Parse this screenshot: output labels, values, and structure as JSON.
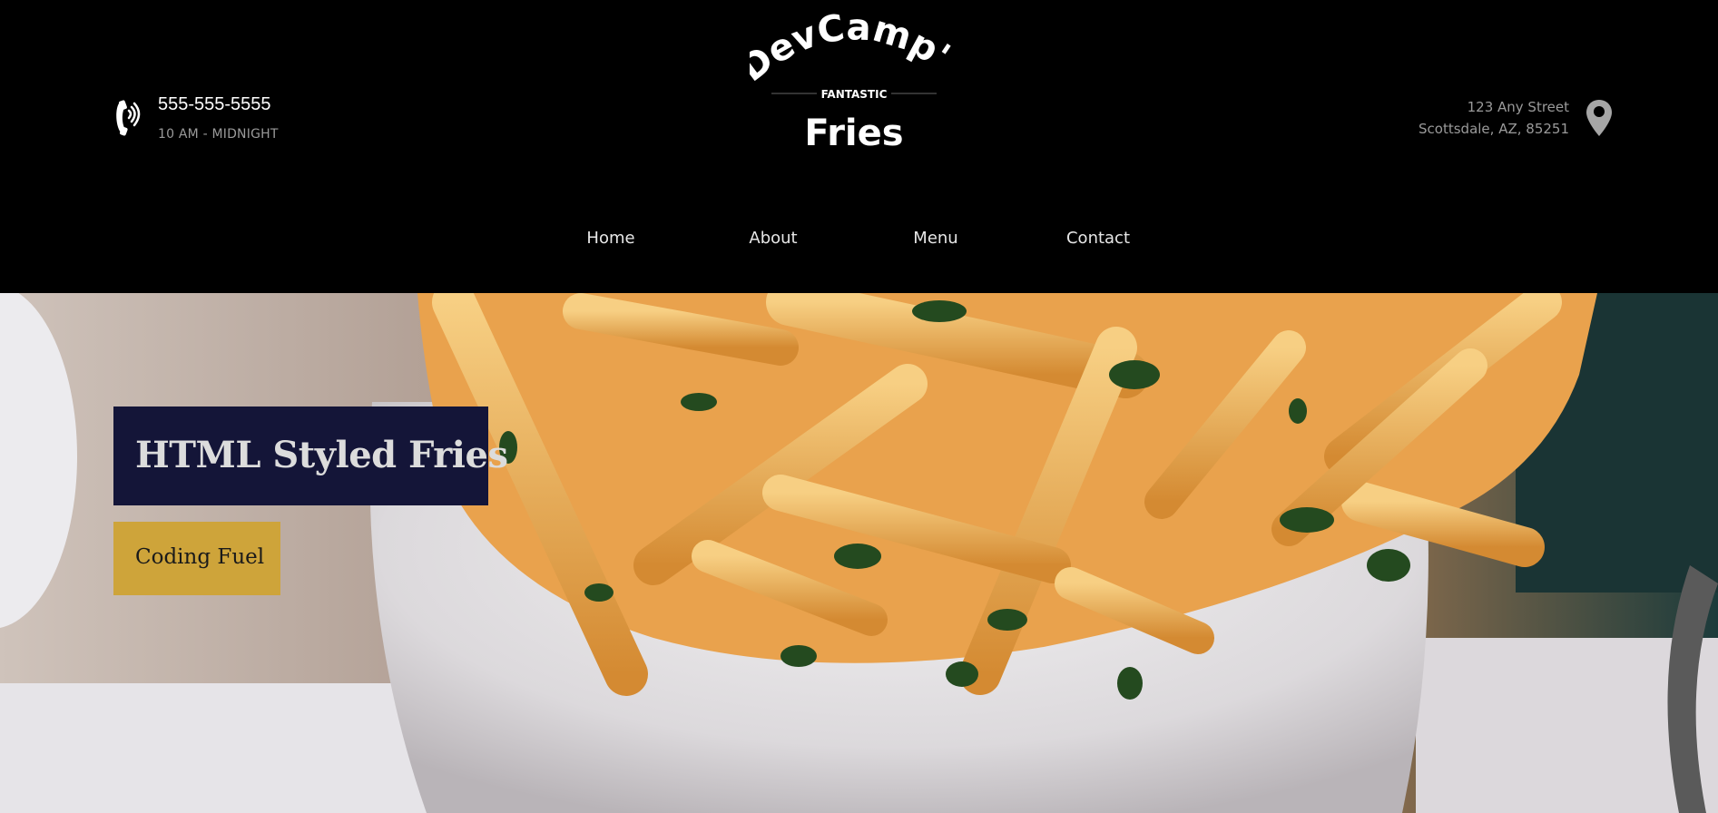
{
  "header": {
    "phone": {
      "icon": "phone-icon",
      "number": "555-555-5555",
      "hours": "10 AM - MIDNIGHT"
    },
    "logo": {
      "top_text": "DevCamp's",
      "middle_text": "FANTASTIC",
      "bottom_text": "Fries"
    },
    "address": {
      "icon": "map-pin-icon",
      "line1": "123 Any Street",
      "line2": "Scottsdale, AZ, 85251"
    }
  },
  "nav": {
    "items": [
      {
        "label": "Home"
      },
      {
        "label": "About"
      },
      {
        "label": "Menu"
      },
      {
        "label": "Contact"
      }
    ]
  },
  "hero": {
    "title": "HTML Styled Fries",
    "button_label": "Coding Fuel",
    "colors": {
      "title_bg": "#141538",
      "button_bg": "#cea43a"
    }
  }
}
